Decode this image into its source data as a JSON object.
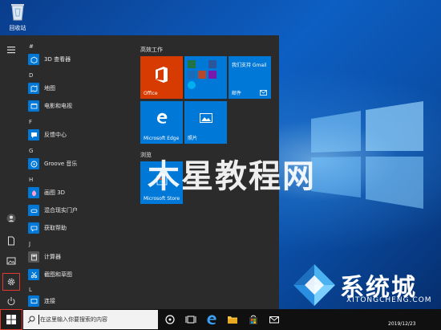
{
  "desktop": {
    "recycle_bin_label": "回收站"
  },
  "start_menu": {
    "app_list": [
      {
        "type": "letter",
        "text": "#"
      },
      {
        "type": "app",
        "name": "3D 查看器",
        "icon": "cube-icon"
      },
      {
        "type": "letter",
        "text": "D"
      },
      {
        "type": "app",
        "name": "地图",
        "icon": "map-icon"
      },
      {
        "type": "app",
        "name": "电影和电视",
        "icon": "film-icon"
      },
      {
        "type": "letter",
        "text": "F"
      },
      {
        "type": "app",
        "name": "反馈中心",
        "icon": "feedback-icon"
      },
      {
        "type": "letter",
        "text": "G"
      },
      {
        "type": "app",
        "name": "Groove 音乐",
        "icon": "groove-icon"
      },
      {
        "type": "letter",
        "text": "H"
      },
      {
        "type": "app",
        "name": "画图 3D",
        "icon": "paint3d-icon"
      },
      {
        "type": "app",
        "name": "混合现实门户",
        "icon": "mixed-reality-icon"
      },
      {
        "type": "app",
        "name": "获取帮助",
        "icon": "help-icon"
      },
      {
        "type": "letter",
        "text": "J"
      },
      {
        "type": "app",
        "name": "计算器",
        "icon": "calculator-icon"
      },
      {
        "type": "app",
        "name": "截图和草图",
        "icon": "snip-icon"
      },
      {
        "type": "letter",
        "text": "L"
      },
      {
        "type": "app",
        "name": "连接",
        "icon": "connect-icon"
      }
    ],
    "tile_groups": [
      {
        "title": "高效工作"
      },
      {
        "title": "浏览"
      }
    ],
    "tiles": {
      "office": "Office",
      "gmail_line1": "我们支持 Gmail",
      "mail": "邮件",
      "edge": "Microsoft Edge",
      "photos": "照片",
      "store": "Microsoft Store"
    }
  },
  "watermark": {
    "main": "木星教程网",
    "brand": "系统城",
    "brand_sub": "XITONGCHENG.COM"
  },
  "taskbar": {
    "search_placeholder": "在这里输入你要搜索的内容",
    "date": "2019/12/23"
  },
  "colors": {
    "accent": "#0078d7",
    "office": "#d83b01",
    "highlight": "#e03b2c",
    "menu_bg": "#2b2b2b",
    "taskbar_bg": "#101010"
  }
}
